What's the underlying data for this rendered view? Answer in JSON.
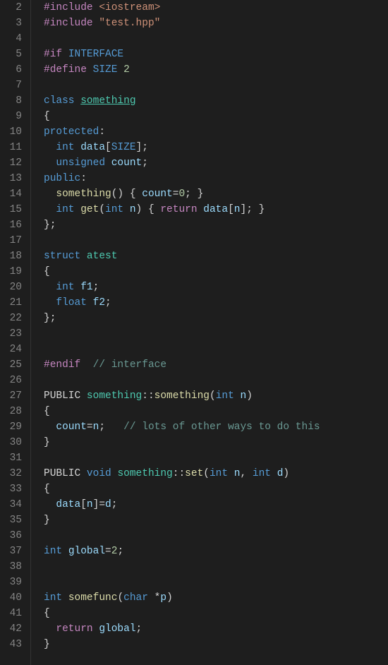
{
  "lines": [
    {
      "num": 2,
      "tokens": [
        {
          "cls": "tok-preproc",
          "t": "#include"
        },
        {
          "cls": "",
          "t": " "
        },
        {
          "cls": "tok-string",
          "t": "<iostream>"
        }
      ]
    },
    {
      "num": 3,
      "tokens": [
        {
          "cls": "tok-preproc",
          "t": "#include"
        },
        {
          "cls": "",
          "t": " "
        },
        {
          "cls": "tok-string",
          "t": "\"test.hpp\""
        }
      ]
    },
    {
      "num": 4,
      "tokens": []
    },
    {
      "num": 5,
      "tokens": [
        {
          "cls": "tok-preproc",
          "t": "#if"
        },
        {
          "cls": "",
          "t": " "
        },
        {
          "cls": "tok-define",
          "t": "INTERFACE"
        }
      ]
    },
    {
      "num": 6,
      "tokens": [
        {
          "cls": "tok-preproc",
          "t": "#define"
        },
        {
          "cls": "",
          "t": " "
        },
        {
          "cls": "tok-define",
          "t": "SIZE"
        },
        {
          "cls": "",
          "t": " "
        },
        {
          "cls": "tok-number",
          "t": "2"
        }
      ]
    },
    {
      "num": 7,
      "tokens": []
    },
    {
      "num": 8,
      "tokens": [
        {
          "cls": "tok-keyword",
          "t": "class"
        },
        {
          "cls": "",
          "t": " "
        },
        {
          "cls": "tok-type underline",
          "t": "something"
        }
      ]
    },
    {
      "num": 9,
      "tokens": [
        {
          "cls": "tok-punct",
          "t": "{"
        }
      ]
    },
    {
      "num": 10,
      "tokens": [
        {
          "cls": "tok-keyword",
          "t": "protected"
        },
        {
          "cls": "tok-punct",
          "t": ":"
        }
      ]
    },
    {
      "num": 11,
      "tokens": [
        {
          "cls": "",
          "t": "  "
        },
        {
          "cls": "tok-keyword",
          "t": "int"
        },
        {
          "cls": "",
          "t": " "
        },
        {
          "cls": "tok-var",
          "t": "data"
        },
        {
          "cls": "tok-punct",
          "t": "["
        },
        {
          "cls": "tok-define",
          "t": "SIZE"
        },
        {
          "cls": "tok-punct",
          "t": "];"
        }
      ]
    },
    {
      "num": 12,
      "tokens": [
        {
          "cls": "",
          "t": "  "
        },
        {
          "cls": "tok-keyword",
          "t": "unsigned"
        },
        {
          "cls": "",
          "t": " "
        },
        {
          "cls": "tok-var",
          "t": "count"
        },
        {
          "cls": "tok-punct",
          "t": ";"
        }
      ]
    },
    {
      "num": 13,
      "tokens": [
        {
          "cls": "tok-keyword",
          "t": "public"
        },
        {
          "cls": "tok-punct",
          "t": ":"
        }
      ]
    },
    {
      "num": 14,
      "tokens": [
        {
          "cls": "",
          "t": "  "
        },
        {
          "cls": "tok-func",
          "t": "something"
        },
        {
          "cls": "tok-punct",
          "t": "() { "
        },
        {
          "cls": "tok-var",
          "t": "count"
        },
        {
          "cls": "tok-punct",
          "t": "="
        },
        {
          "cls": "tok-number",
          "t": "0"
        },
        {
          "cls": "tok-punct",
          "t": "; }"
        }
      ]
    },
    {
      "num": 15,
      "tokens": [
        {
          "cls": "",
          "t": "  "
        },
        {
          "cls": "tok-keyword",
          "t": "int"
        },
        {
          "cls": "",
          "t": " "
        },
        {
          "cls": "tok-func",
          "t": "get"
        },
        {
          "cls": "tok-punct",
          "t": "("
        },
        {
          "cls": "tok-keyword",
          "t": "int"
        },
        {
          "cls": "",
          "t": " "
        },
        {
          "cls": "tok-var",
          "t": "n"
        },
        {
          "cls": "tok-punct",
          "t": ") { "
        },
        {
          "cls": "tok-preproc",
          "t": "return"
        },
        {
          "cls": "",
          "t": " "
        },
        {
          "cls": "tok-var",
          "t": "data"
        },
        {
          "cls": "tok-punct",
          "t": "["
        },
        {
          "cls": "tok-var",
          "t": "n"
        },
        {
          "cls": "tok-punct",
          "t": "]; }"
        }
      ]
    },
    {
      "num": 16,
      "tokens": [
        {
          "cls": "tok-punct",
          "t": "};"
        }
      ]
    },
    {
      "num": 17,
      "tokens": []
    },
    {
      "num": 18,
      "tokens": [
        {
          "cls": "tok-keyword",
          "t": "struct"
        },
        {
          "cls": "",
          "t": " "
        },
        {
          "cls": "tok-type",
          "t": "atest"
        }
      ]
    },
    {
      "num": 19,
      "tokens": [
        {
          "cls": "tok-punct",
          "t": "{"
        }
      ]
    },
    {
      "num": 20,
      "tokens": [
        {
          "cls": "",
          "t": "  "
        },
        {
          "cls": "tok-keyword",
          "t": "int"
        },
        {
          "cls": "",
          "t": " "
        },
        {
          "cls": "tok-var",
          "t": "f1"
        },
        {
          "cls": "tok-punct",
          "t": ";"
        }
      ]
    },
    {
      "num": 21,
      "tokens": [
        {
          "cls": "",
          "t": "  "
        },
        {
          "cls": "tok-keyword",
          "t": "float"
        },
        {
          "cls": "",
          "t": " "
        },
        {
          "cls": "tok-var",
          "t": "f2"
        },
        {
          "cls": "tok-punct",
          "t": ";"
        }
      ]
    },
    {
      "num": 22,
      "tokens": [
        {
          "cls": "tok-punct",
          "t": "};"
        }
      ]
    },
    {
      "num": 23,
      "tokens": []
    },
    {
      "num": 24,
      "tokens": []
    },
    {
      "num": 25,
      "tokens": [
        {
          "cls": "tok-preproc",
          "t": "#endif"
        },
        {
          "cls": "",
          "t": "  "
        },
        {
          "cls": "tok-comment",
          "t": "// interface"
        }
      ]
    },
    {
      "num": 26,
      "tokens": []
    },
    {
      "num": 27,
      "tokens": [
        {
          "cls": "tok-punct",
          "t": "PUBLIC "
        },
        {
          "cls": "tok-type",
          "t": "something"
        },
        {
          "cls": "tok-punct",
          "t": "::"
        },
        {
          "cls": "tok-func",
          "t": "something"
        },
        {
          "cls": "tok-punct",
          "t": "("
        },
        {
          "cls": "tok-keyword",
          "t": "int"
        },
        {
          "cls": "",
          "t": " "
        },
        {
          "cls": "tok-var",
          "t": "n"
        },
        {
          "cls": "tok-punct",
          "t": ")"
        }
      ]
    },
    {
      "num": 28,
      "tokens": [
        {
          "cls": "tok-punct",
          "t": "{"
        }
      ]
    },
    {
      "num": 29,
      "tokens": [
        {
          "cls": "",
          "t": "  "
        },
        {
          "cls": "tok-var",
          "t": "count"
        },
        {
          "cls": "tok-punct",
          "t": "="
        },
        {
          "cls": "tok-var",
          "t": "n"
        },
        {
          "cls": "tok-punct",
          "t": ";   "
        },
        {
          "cls": "tok-comment",
          "t": "// lots of other ways to do this"
        }
      ]
    },
    {
      "num": 30,
      "tokens": [
        {
          "cls": "tok-punct",
          "t": "}"
        }
      ]
    },
    {
      "num": 31,
      "tokens": []
    },
    {
      "num": 32,
      "tokens": [
        {
          "cls": "tok-punct",
          "t": "PUBLIC "
        },
        {
          "cls": "tok-keyword",
          "t": "void"
        },
        {
          "cls": "",
          "t": " "
        },
        {
          "cls": "tok-type",
          "t": "something"
        },
        {
          "cls": "tok-punct",
          "t": "::"
        },
        {
          "cls": "tok-func",
          "t": "set"
        },
        {
          "cls": "tok-punct",
          "t": "("
        },
        {
          "cls": "tok-keyword",
          "t": "int"
        },
        {
          "cls": "",
          "t": " "
        },
        {
          "cls": "tok-var",
          "t": "n"
        },
        {
          "cls": "tok-punct",
          "t": ", "
        },
        {
          "cls": "tok-keyword",
          "t": "int"
        },
        {
          "cls": "",
          "t": " "
        },
        {
          "cls": "tok-var",
          "t": "d"
        },
        {
          "cls": "tok-punct",
          "t": ")"
        }
      ]
    },
    {
      "num": 33,
      "tokens": [
        {
          "cls": "tok-punct",
          "t": "{"
        }
      ]
    },
    {
      "num": 34,
      "tokens": [
        {
          "cls": "",
          "t": "  "
        },
        {
          "cls": "tok-var",
          "t": "data"
        },
        {
          "cls": "tok-punct",
          "t": "["
        },
        {
          "cls": "tok-var",
          "t": "n"
        },
        {
          "cls": "tok-punct",
          "t": "]="
        },
        {
          "cls": "tok-var",
          "t": "d"
        },
        {
          "cls": "tok-punct",
          "t": ";"
        }
      ]
    },
    {
      "num": 35,
      "tokens": [
        {
          "cls": "tok-punct",
          "t": "}"
        }
      ]
    },
    {
      "num": 36,
      "tokens": []
    },
    {
      "num": 37,
      "tokens": [
        {
          "cls": "tok-keyword",
          "t": "int"
        },
        {
          "cls": "",
          "t": " "
        },
        {
          "cls": "tok-var",
          "t": "global"
        },
        {
          "cls": "tok-punct",
          "t": "="
        },
        {
          "cls": "tok-number",
          "t": "2"
        },
        {
          "cls": "tok-punct",
          "t": ";"
        }
      ]
    },
    {
      "num": 38,
      "tokens": []
    },
    {
      "num": 39,
      "tokens": []
    },
    {
      "num": 40,
      "tokens": [
        {
          "cls": "tok-keyword",
          "t": "int"
        },
        {
          "cls": "",
          "t": " "
        },
        {
          "cls": "tok-func",
          "t": "somefunc"
        },
        {
          "cls": "tok-punct",
          "t": "("
        },
        {
          "cls": "tok-keyword",
          "t": "char"
        },
        {
          "cls": "",
          "t": " "
        },
        {
          "cls": "tok-punct",
          "t": "*"
        },
        {
          "cls": "tok-var",
          "t": "p"
        },
        {
          "cls": "tok-punct",
          "t": ")"
        }
      ]
    },
    {
      "num": 41,
      "tokens": [
        {
          "cls": "tok-punct",
          "t": "{"
        }
      ]
    },
    {
      "num": 42,
      "tokens": [
        {
          "cls": "",
          "t": "  "
        },
        {
          "cls": "tok-preproc",
          "t": "return"
        },
        {
          "cls": "",
          "t": " "
        },
        {
          "cls": "tok-var",
          "t": "global"
        },
        {
          "cls": "tok-punct",
          "t": ";"
        }
      ]
    },
    {
      "num": 43,
      "tokens": [
        {
          "cls": "tok-punct",
          "t": "}"
        }
      ]
    }
  ]
}
